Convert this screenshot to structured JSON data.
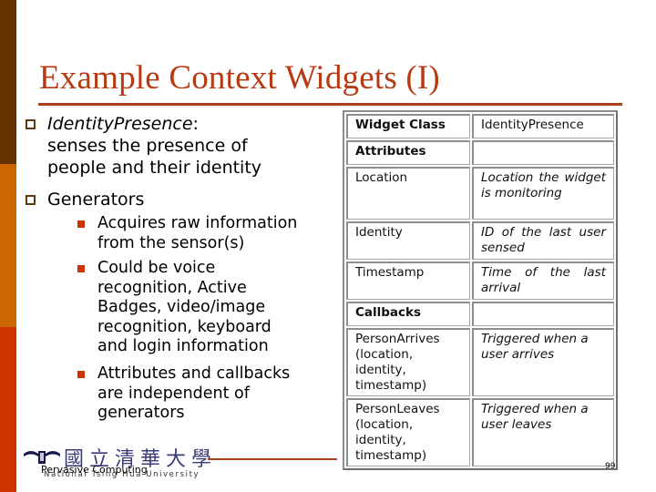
{
  "slide": {
    "title": "Example Context Widgets (I)",
    "colors": {
      "title": "#b83a12",
      "rule": "#a9421c",
      "sidebar_top": "#663300",
      "sidebar_mid": "#cc6600",
      "sidebar_bottom": "#cc3300",
      "bullet_level1": "#5a3a12",
      "bullet_level2": "#cc3300"
    }
  },
  "bullets": [
    {
      "icon": "hollow-square-bullet",
      "lines": [
        {
          "italic": "IdentityPresence",
          "rest": ":"
        },
        {
          "text": "senses the presence of"
        },
        {
          "text": "people and their identity"
        }
      ]
    },
    {
      "icon": "hollow-square-bullet",
      "lines": [
        {
          "text": "Generators"
        }
      ],
      "sub": [
        {
          "icon": "filled-square-bullet",
          "lines": [
            "Acquires raw information",
            "from the sensor(s)"
          ]
        },
        {
          "icon": "filled-square-bullet",
          "lines": [
            "Could be voice",
            "recognition, Active",
            "Badges, video/image",
            "recognition, keyboard",
            "and login information"
          ]
        },
        {
          "icon": "filled-square-bullet",
          "lines": [
            "Attributes and callbacks",
            "are independent of",
            "generators"
          ]
        }
      ]
    }
  ],
  "table": {
    "rows": [
      {
        "c1": "Widget Class",
        "c1_bold": true,
        "c2": "IdentityPresence"
      },
      {
        "c1": "Attributes",
        "c1_bold": true,
        "c2": ""
      },
      {
        "c1": "Location",
        "c2": "Location the widget is monitoring",
        "c2_italic": true
      },
      {
        "c1": "Identity",
        "c2": "ID of the last user sensed",
        "c2_italic": true
      },
      {
        "c1": "Timestamp",
        "c2": "Time of the last arrival",
        "c2_italic": true
      },
      {
        "c1": "Callbacks",
        "c1_bold": true,
        "c2": ""
      },
      {
        "c1": "PersonArrives (location, identity, timestamp)",
        "c2": "Triggered when a user arrives",
        "c2_italic": true
      },
      {
        "c1": "PersonLeaves (location, identity, timestamp)",
        "c2": "Triggered when a user leaves",
        "c2_italic": true
      }
    ]
  },
  "footer": {
    "logo_icon": "university-emblem-icon",
    "logo_chinese": "國立清華大學",
    "logo_english": "National Tsing Hua University",
    "course": "Pervasive Computing",
    "page_number": "99"
  }
}
